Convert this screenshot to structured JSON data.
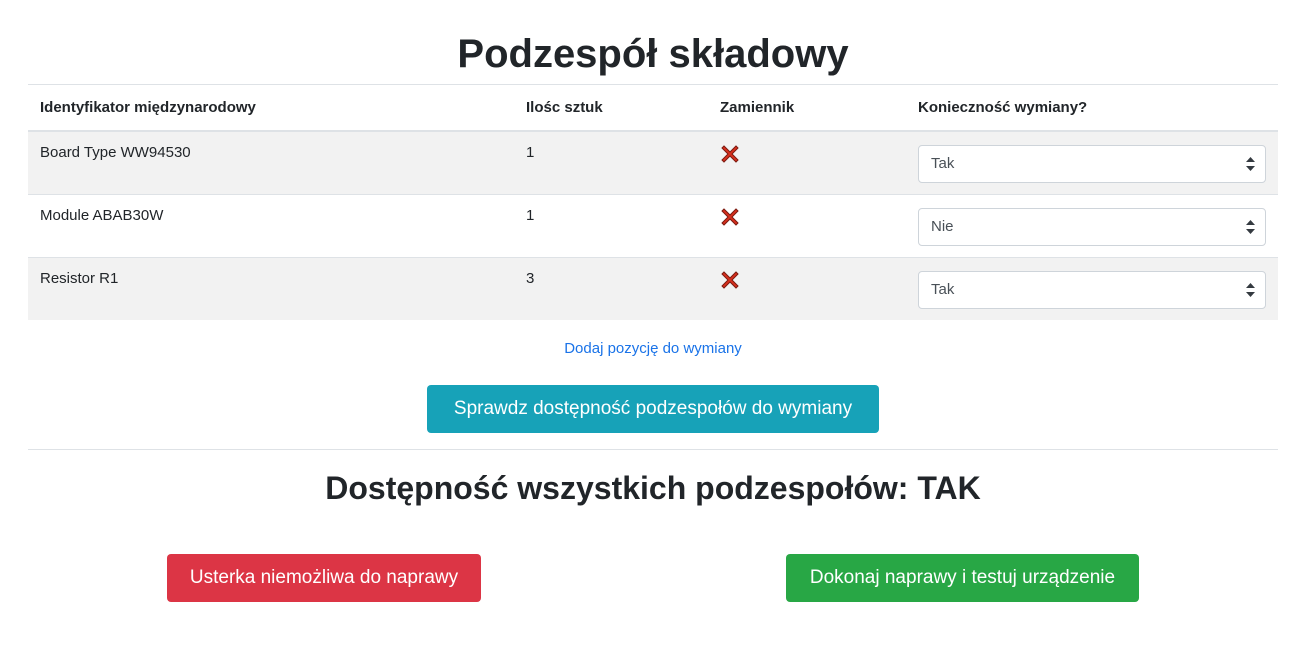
{
  "page": {
    "title": "Podzespół składowy",
    "availability_text": "Dostępność wszystkich podzespołów: TAK"
  },
  "table": {
    "headers": [
      "Identyfikator międzynarodowy",
      "Ilośc sztuk",
      "Zamiennik",
      "Konieczność wymiany?"
    ],
    "rows": [
      {
        "id": "Board Type WW94530",
        "qty": "1",
        "replacement": "x-icon",
        "replace_needed": "Tak"
      },
      {
        "id": "Module ABAB30W",
        "qty": "1",
        "replacement": "x-icon",
        "replace_needed": "Nie"
      },
      {
        "id": "Resistor R1",
        "qty": "3",
        "replacement": "x-icon",
        "replace_needed": "Tak"
      }
    ]
  },
  "actions": {
    "add_link": "Dodaj pozycję do wymiany",
    "check_button": "Sprawdz dostępność podzespołów do wymiany",
    "cannot_repair_button": "Usterka niemożliwa do naprawy",
    "repair_button": "Dokonaj naprawy i testuj urządzenie"
  },
  "colors": {
    "info": "#17a2b8",
    "danger": "#dc3545",
    "success": "#28a745",
    "link": "#1a73e8",
    "x_icon": "#d9301e"
  }
}
